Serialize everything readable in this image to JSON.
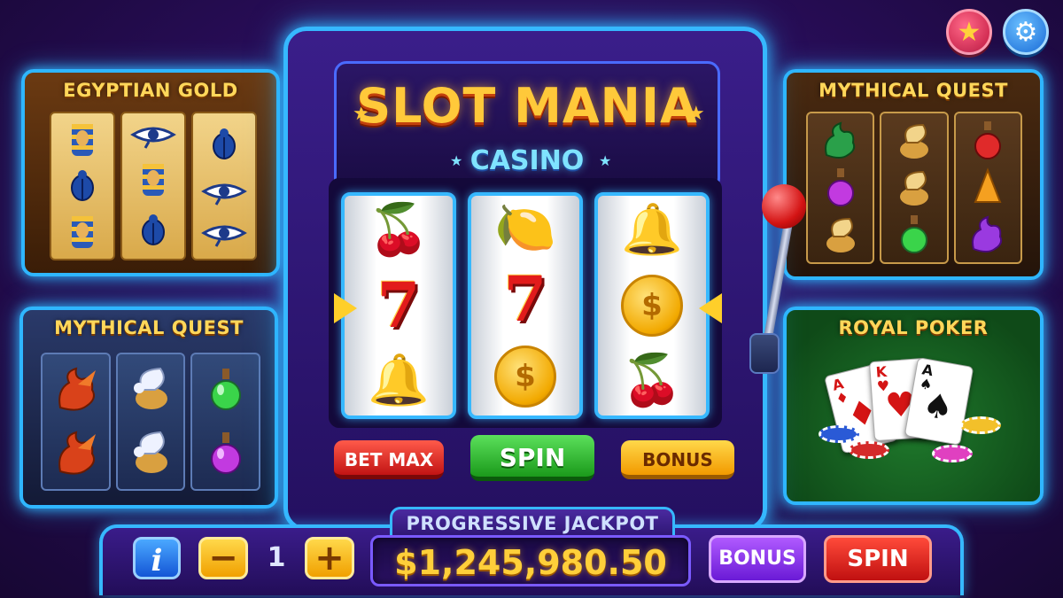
{
  "machine": {
    "title": "SLOT MANIA",
    "subtitle": "CASINO",
    "reels": [
      [
        "🍒",
        "7",
        "🔔"
      ],
      [
        "🍋",
        "7",
        "$"
      ],
      [
        "🔔",
        "$",
        "🍒"
      ]
    ],
    "buttons": {
      "bet_max": "BET MAX",
      "spin": "SPIN",
      "bonus": "BONUS"
    }
  },
  "side_games": {
    "egyptian": {
      "title": "EGYPTIAN GOLD",
      "symbols": [
        [
          "pharaoh",
          "scarab",
          "pharaoh"
        ],
        [
          "eye-of-horus",
          "pharaoh",
          "scarab"
        ],
        [
          "scarab",
          "eye-of-horus",
          "eye-of-horus"
        ]
      ]
    },
    "mythical_left": {
      "title": "MYTHICAL QUEST",
      "symbols": [
        [
          "dragon",
          "dragon"
        ],
        [
          "griffin",
          "griffin"
        ],
        [
          "green-potion",
          "purple-potion"
        ]
      ]
    },
    "mythical_right": {
      "title": "MYTHICAL QUEST",
      "symbols": [
        [
          "dragon",
          "purple-potion",
          "griffin"
        ],
        [
          "griffin",
          "griffin",
          "green-potion"
        ],
        [
          "red-potion",
          "orange-potion",
          "purple-dragon"
        ]
      ]
    },
    "poker": {
      "title": "ROYAL POKER",
      "cards": [
        {
          "rank": "A",
          "suit": "♦"
        },
        {
          "rank": "K",
          "suit": "♥"
        },
        {
          "rank": "A",
          "suit": "♠"
        }
      ]
    }
  },
  "bottom_bar": {
    "info": "i",
    "minus": "−",
    "bet": "1",
    "plus": "+",
    "jackpot_label": "PROGRESSIVE JACKPOT",
    "jackpot_value": "$1,245,980.50",
    "bonus": "BONUS",
    "spin": "SPIN"
  },
  "top_icons": {
    "favorite": "★",
    "settings": "⚙"
  },
  "colors": {
    "neon_blue": "#2fb6ff",
    "gold": "#ffc93a",
    "spin_green": "#1b9a1b",
    "bet_red": "#c21414",
    "bonus_purple": "#6a1ad6"
  }
}
